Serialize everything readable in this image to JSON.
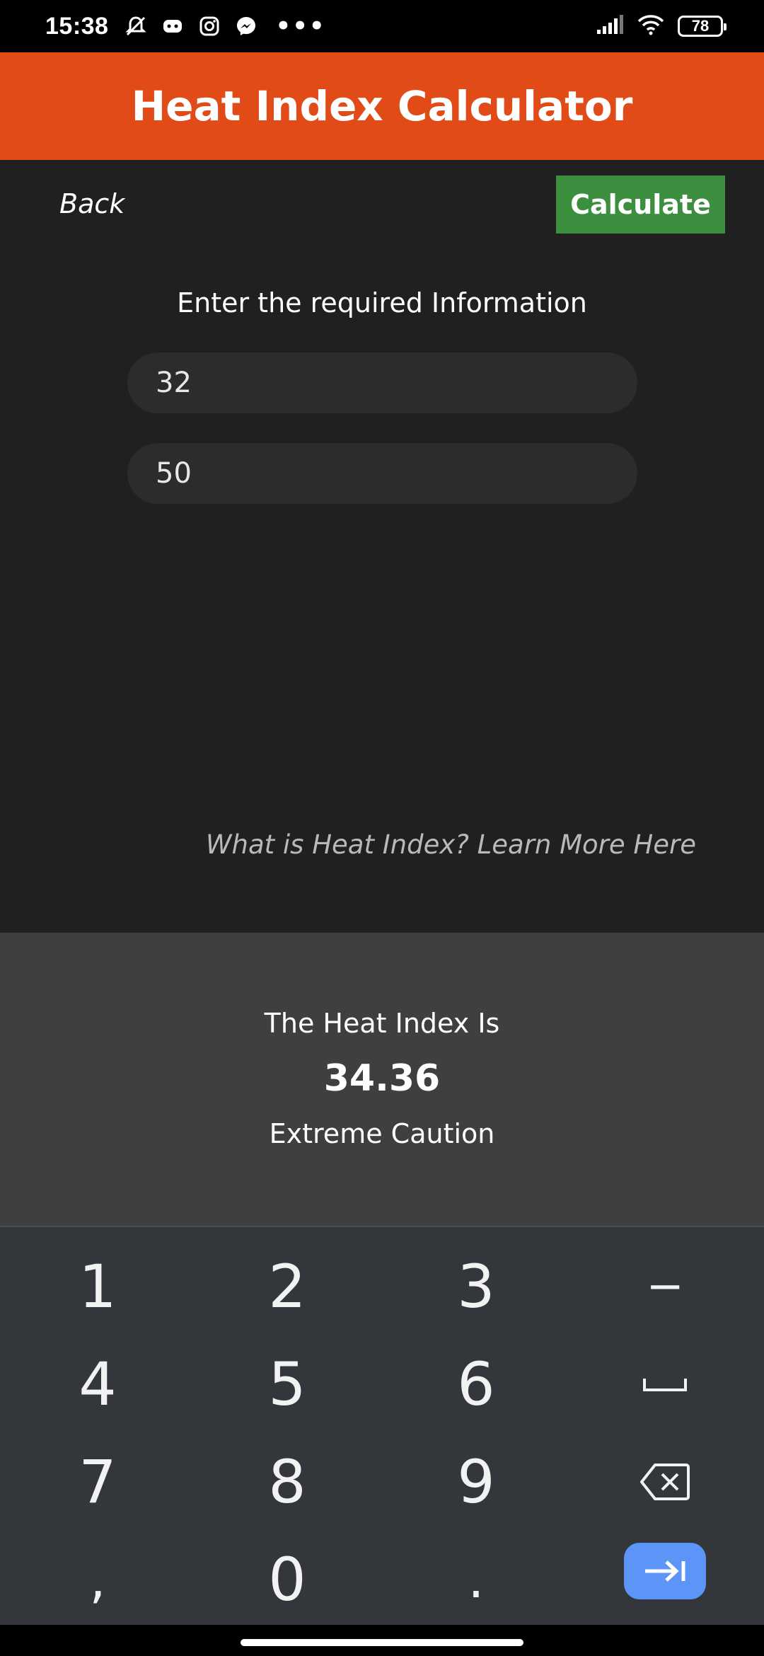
{
  "status_bar": {
    "time": "15:38",
    "left_icons": [
      "mute-bell-icon",
      "discord-icon",
      "instagram-icon",
      "messenger-icon"
    ],
    "overflow": "•••",
    "battery": "78"
  },
  "header": {
    "title": "Heat Index Calculator",
    "color": "#e04b18"
  },
  "toolbar": {
    "back_label": "Back",
    "calculate_label": "Calculate",
    "calculate_color": "#3b8f3e"
  },
  "form": {
    "prompt": "Enter the required Information",
    "temperature_value": "32",
    "humidity_value": "50",
    "learn_more": "What is Heat Index? Learn More Here"
  },
  "result": {
    "label": "The Heat Index Is",
    "value": "34.36",
    "status": "Extreme Caution"
  },
  "keyboard": {
    "keys": [
      "1",
      "2",
      "3",
      "−",
      "4",
      "5",
      "6",
      "space",
      "7",
      "8",
      "9",
      "backspace",
      ",",
      "0",
      ".",
      "enter"
    ],
    "enter_color": "#5c94f7"
  }
}
